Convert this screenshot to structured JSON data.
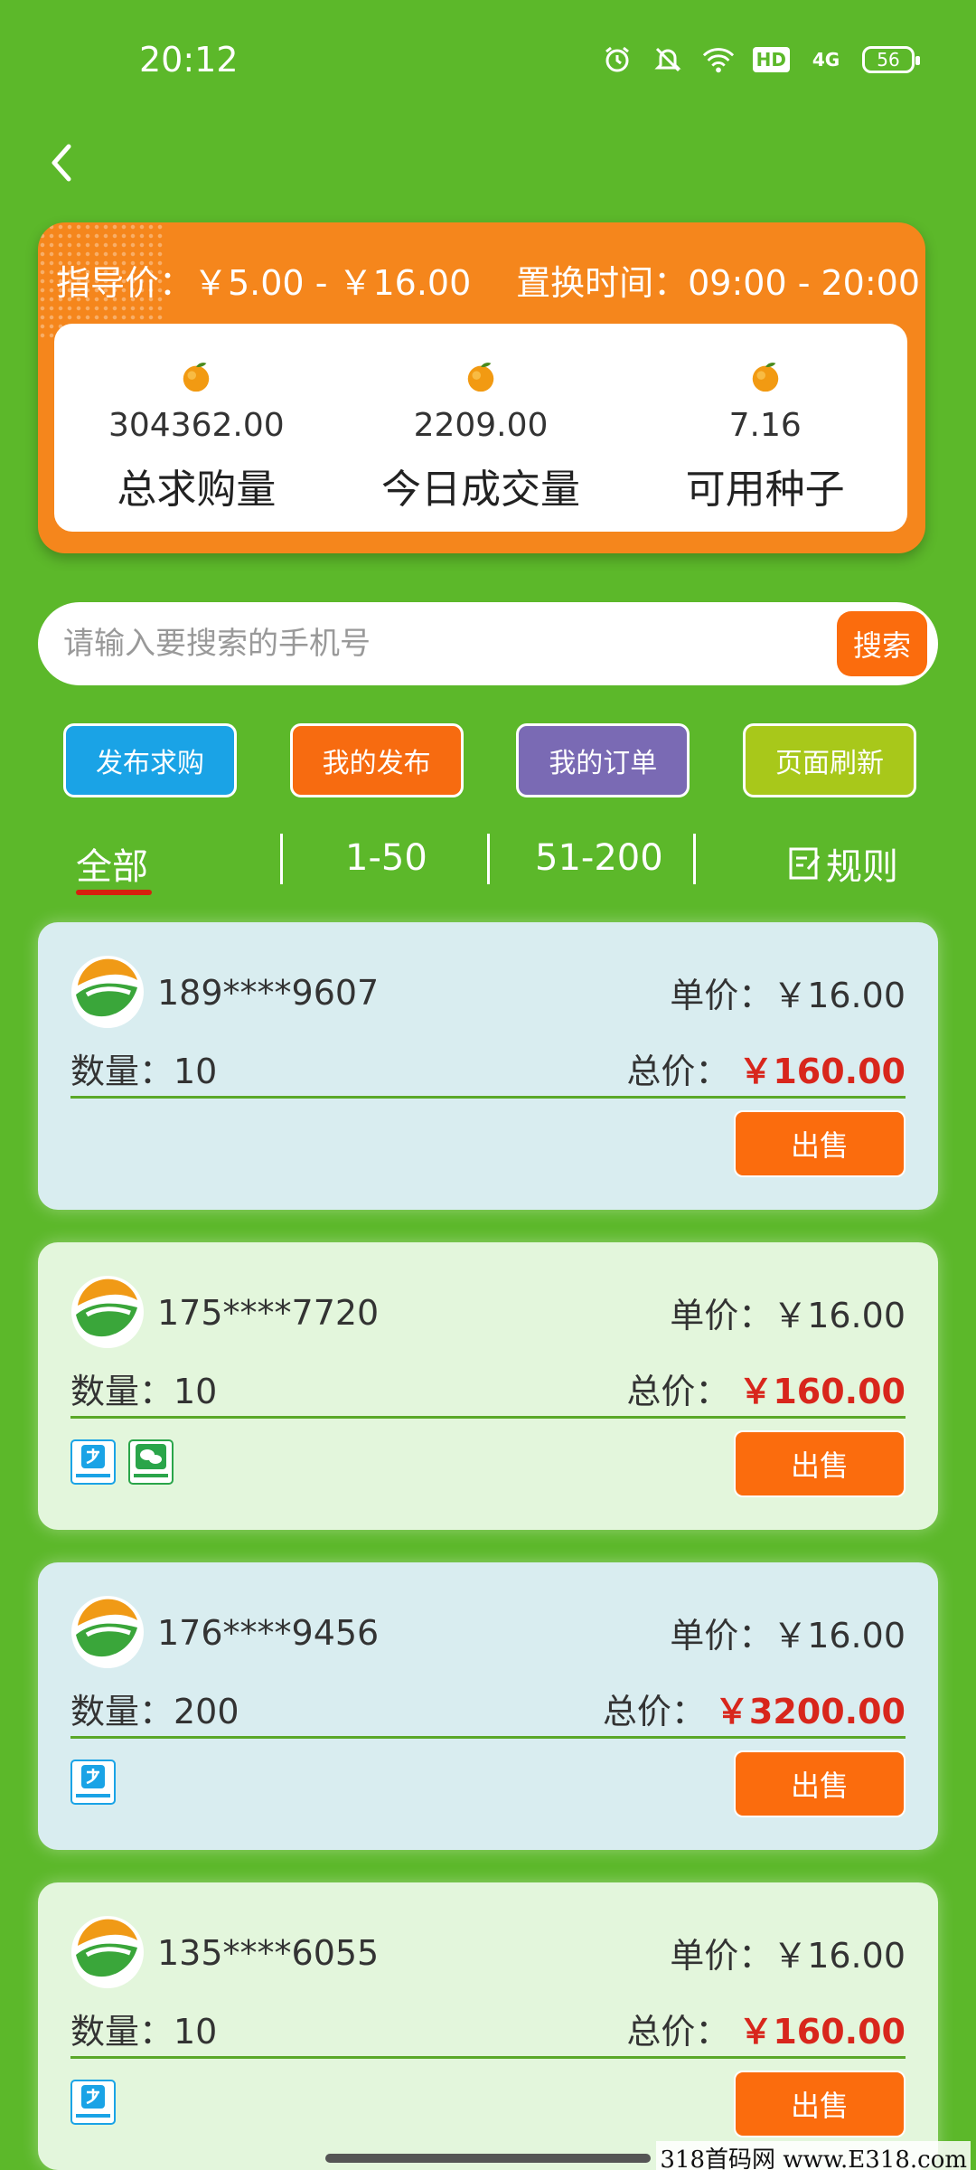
{
  "status_bar": {
    "time": "20:12",
    "network": "4G",
    "hd": "HD",
    "battery": "56",
    "icons": [
      "alarm-icon",
      "mute-bell-icon",
      "wifi-icon",
      "hd-icon",
      "signal-icon",
      "battery-icon"
    ]
  },
  "header": {
    "back_icon": "chevron-left-icon"
  },
  "info": {
    "guide_price": "指导价：￥5.00 - ￥16.00",
    "swap_time": "置换时间：09:00 - 20:00",
    "stats": [
      {
        "value": "304362.00",
        "label": "总求购量"
      },
      {
        "value": "2209.00",
        "label": "今日成交量"
      },
      {
        "value": "7.16",
        "label": "可用种子"
      }
    ]
  },
  "search": {
    "placeholder": "请输入要搜索的手机号",
    "button": "搜索"
  },
  "actions": {
    "publish_request": "发布求购",
    "my_posts": "我的发布",
    "my_orders": "我的订单",
    "refresh": "页面刷新"
  },
  "tabs": {
    "all": "全部",
    "range1": "1-50",
    "range2": "51-200",
    "rules": "规则"
  },
  "listings": [
    {
      "phone": "189****9607",
      "unit_price": "单价：￥16.00",
      "quantity": "数量：10",
      "total_label": "总价：",
      "total": "￥160.00",
      "sell": "出售",
      "payments": []
    },
    {
      "phone": "175****7720",
      "unit_price": "单价：￥16.00",
      "quantity": "数量：10",
      "total_label": "总价：",
      "total": "￥160.00",
      "sell": "出售",
      "payments": [
        "alipay",
        "wechat"
      ]
    },
    {
      "phone": "176****9456",
      "unit_price": "单价：￥16.00",
      "quantity": "数量：200",
      "total_label": "总价：",
      "total": "￥3200.00",
      "sell": "出售",
      "payments": [
        "alipay"
      ]
    },
    {
      "phone": "135****6055",
      "unit_price": "单价：￥16.00",
      "quantity": "数量：10",
      "total_label": "总价：",
      "total": "￥160.00",
      "sell": "出售",
      "payments": [
        "alipay"
      ]
    }
  ],
  "watermark": "318首码网 www.E318.com",
  "colors": {
    "background": "#5cb82a",
    "card_orange": "#f5861c",
    "sell_button": "#fb6c0d",
    "price_red": "#d8261c",
    "btn_blue": "#1aa3e6",
    "btn_orange": "#f76b10",
    "btn_purple": "#7a6ab4",
    "btn_lime": "#a8c81a"
  }
}
